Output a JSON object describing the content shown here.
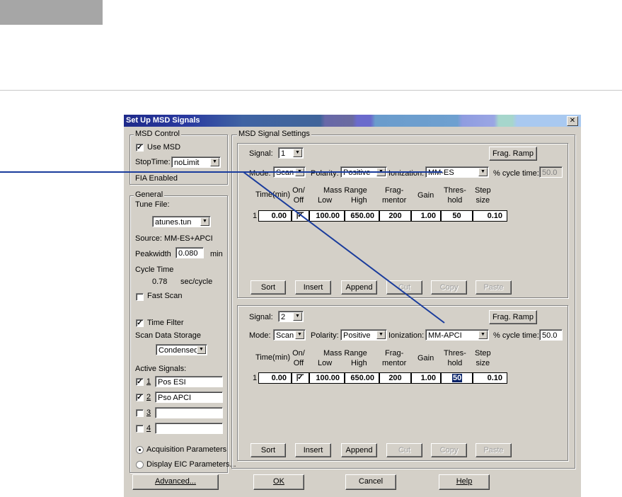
{
  "dialog": {
    "title": "Set Up MSD Signals",
    "close": "✕"
  },
  "msd_control": {
    "label": "MSD Control",
    "use_msd": {
      "label": "Use MSD",
      "checked": true
    },
    "stoptime_label": "StopTime:",
    "stoptime_value": "noLimit",
    "fia": "FIA Enabled"
  },
  "general": {
    "label": "General",
    "tune_file_label": "Tune File:",
    "tune_file_value": "atunes.tun",
    "source": "Source:  MM-ES+APCI",
    "peakwidth_label": "Peakwidth",
    "peakwidth_value": "0.080",
    "peakwidth_unit": "min",
    "cycle_time_label": "Cycle Time",
    "cycle_time_value": "0.78",
    "cycle_time_unit": "sec/cycle",
    "fast_scan": "Fast Scan",
    "time_filter": "Time Filter",
    "scan_storage_label": "Scan Data Storage",
    "scan_storage_value": "Condensed",
    "active_signals_label": "Active Signals:",
    "active_signals": [
      {
        "num": "1",
        "checked": true,
        "value": "Pos ESI"
      },
      {
        "num": "2",
        "checked": true,
        "value": "Pso APCI"
      },
      {
        "num": "3",
        "checked": false,
        "value": ""
      },
      {
        "num": "4",
        "checked": false,
        "value": ""
      }
    ],
    "acq_params": "Acquisition Parameters",
    "display_eic": "Display EIC Parameters..."
  },
  "settings_label": "MSD Signal Settings",
  "headers": {
    "time": "Time(min)",
    "onoff": "On/\nOff",
    "mass_range": "Mass Range",
    "low": "Low",
    "high": "High",
    "frag": "Frag-\nmentor",
    "gain": "Gain",
    "thresh": "Thres-\nhold",
    "step": "Step\nsize"
  },
  "labels": {
    "signal": "Signal:",
    "mode": "Mode:",
    "polarity": "Polarity:",
    "ionization": "Ionization:",
    "cycle_pct": "% cycle time:",
    "frag_ramp": "Frag. Ramp"
  },
  "signals": [
    {
      "signal": "1",
      "mode": "Scan",
      "polarity": "Positive",
      "ionization": "MM-ES",
      "cycle_pct": "50.0",
      "row": {
        "index": "1",
        "time": "0.00",
        "on": true,
        "low": "100.00",
        "high": "650.00",
        "frag": "200",
        "gain": "1.00",
        "thresh": "50",
        "step": "0.10"
      }
    },
    {
      "signal": "2",
      "mode": "Scan",
      "polarity": "Positive",
      "ionization": "MM-APCI",
      "cycle_pct": "50.0",
      "row": {
        "index": "1",
        "time": "0.00",
        "on": true,
        "low": "100.00",
        "high": "650.00",
        "frag": "200",
        "gain": "1.00",
        "thresh": "50",
        "step": "0.10"
      }
    }
  ],
  "row_buttons": [
    "Sort",
    "Insert",
    "Append",
    "Cut",
    "Copy",
    "Paste"
  ],
  "footer": {
    "advanced": "Advanced...",
    "ok": "OK",
    "cancel": "Cancel",
    "help": "Help"
  },
  "colors": {
    "callout_line": "#1a3c9c",
    "selection": "#0a246a"
  }
}
